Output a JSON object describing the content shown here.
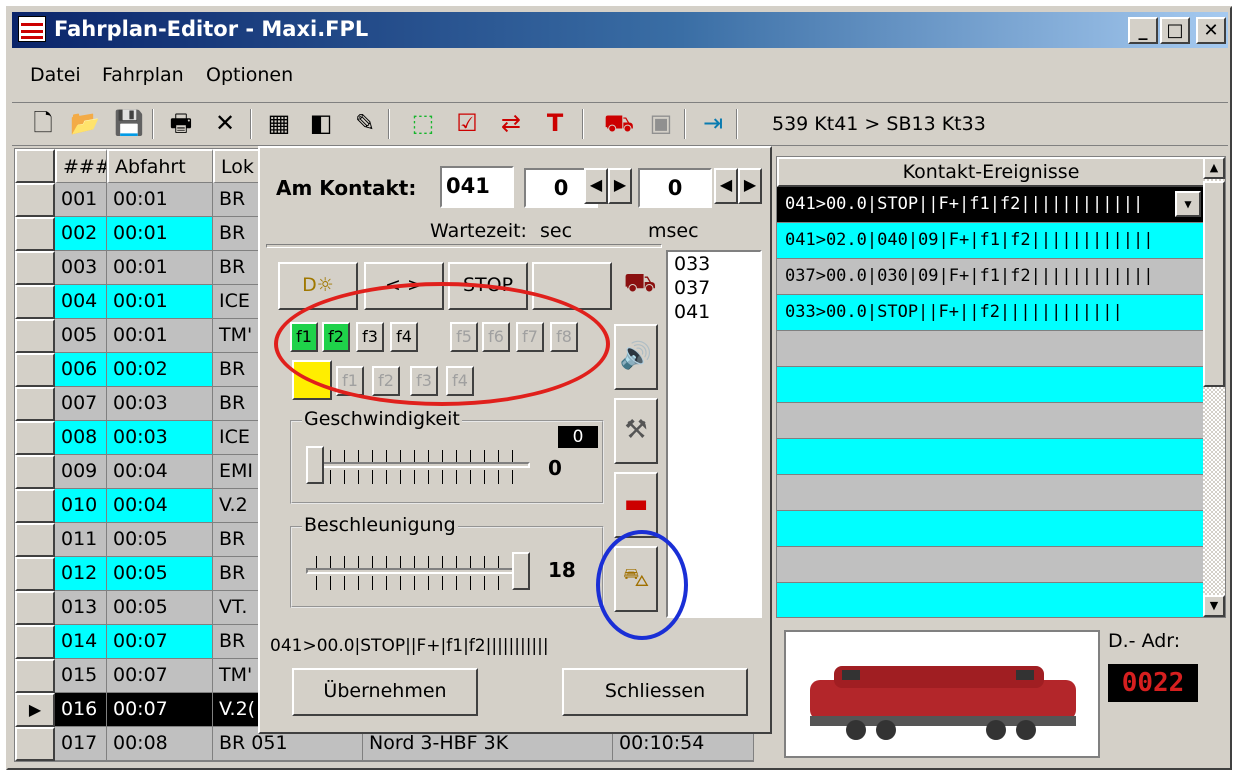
{
  "window": {
    "title": "Fahrplan-Editor - Maxi.FPL",
    "min": "_",
    "max": "□",
    "close": "✕"
  },
  "menu": [
    "Datei",
    "Fahrplan",
    "Optionen"
  ],
  "toolbar": {
    "icons": [
      "new-icon",
      "open-icon",
      "save-icon",
      "print-icon",
      "delete-icon",
      "table-icon",
      "panel-icon",
      "pencil-icon",
      "select-icon",
      "chart-icon",
      "swap-icon",
      "text-icon",
      "loco-icon",
      "disk-icon",
      "exit-icon"
    ],
    "route": "539 Kt41 > SB13 Kt33"
  },
  "grid": {
    "headers": [
      "###",
      "Abfahrt",
      "Lok"
    ],
    "rows": [
      {
        "n": "001",
        "t": "00:01",
        "lok": "BR"
      },
      {
        "n": "002",
        "t": "00:01",
        "lok": "BR"
      },
      {
        "n": "003",
        "t": "00:01",
        "lok": "BR"
      },
      {
        "n": "004",
        "t": "00:01",
        "lok": "ICE"
      },
      {
        "n": "005",
        "t": "00:01",
        "lok": "TM'"
      },
      {
        "n": "006",
        "t": "00:02",
        "lok": "BR"
      },
      {
        "n": "007",
        "t": "00:03",
        "lok": "BR"
      },
      {
        "n": "008",
        "t": "00:03",
        "lok": "ICE"
      },
      {
        "n": "009",
        "t": "00:04",
        "lok": "EMI"
      },
      {
        "n": "010",
        "t": "00:04",
        "lok": "V.2"
      },
      {
        "n": "011",
        "t": "00:05",
        "lok": "BR"
      },
      {
        "n": "012",
        "t": "00:05",
        "lok": "BR"
      },
      {
        "n": "013",
        "t": "00:05",
        "lok": "VT."
      },
      {
        "n": "014",
        "t": "00:07",
        "lok": "BR"
      },
      {
        "n": "015",
        "t": "00:07",
        "lok": "TM'"
      },
      {
        "n": "016",
        "t": "00:07",
        "lok": "V.2("
      },
      {
        "n": "017",
        "t": "00:08",
        "lok": "BR 051",
        "route": "Nord 3-HBF 3K",
        "time": "00:10:54"
      }
    ]
  },
  "dialog": {
    "am_kontakt_label": "Am Kontakt:",
    "kontakt_value": "041",
    "sec_value": "0",
    "msec_value": "0",
    "wartezeit_label": "Wartezeit:",
    "sec_label": "sec",
    "msec_label": "msec",
    "btn_light": "D☼",
    "btn_dir": "< >",
    "btn_stop": "STOP",
    "fkeys": [
      "f1",
      "f2",
      "f3",
      "f4",
      "f5",
      "f6",
      "f7",
      "f8"
    ],
    "fkeys2": [
      "f1",
      "f2",
      "f3",
      "f4"
    ],
    "kontakt_list": [
      "033",
      "037",
      "041"
    ],
    "geschwindigkeit_label": "Geschwindigkeit",
    "speed_display": "0",
    "speed_value": "0",
    "beschleunigung_label": "Beschleunigung",
    "accel_value": "18",
    "status": "041>00.0|STOP||F+|f1|f2|||||||||||",
    "btn_uebernehmen": "Übernehmen",
    "btn_schliessen": "Schliessen"
  },
  "events": {
    "header": "Kontakt-Ereignisse",
    "rows": [
      "041>00.0|STOP||F+|f1|f2||||||||||||",
      "041>02.0|040|09|F+|f1|f2||||||||||||",
      "037>00.0|030|09|F+|f1|f2||||||||||||",
      "033>00.0|STOP||F+||f2||||||||||||"
    ]
  },
  "dadr": {
    "label": "D.- Adr:",
    "value": "0022"
  },
  "colors": {
    "cyan": "#00ffff",
    "gray": "#c0c0c0",
    "highlight_red": "#e0201c",
    "highlight_blue": "#1a2fd6"
  }
}
